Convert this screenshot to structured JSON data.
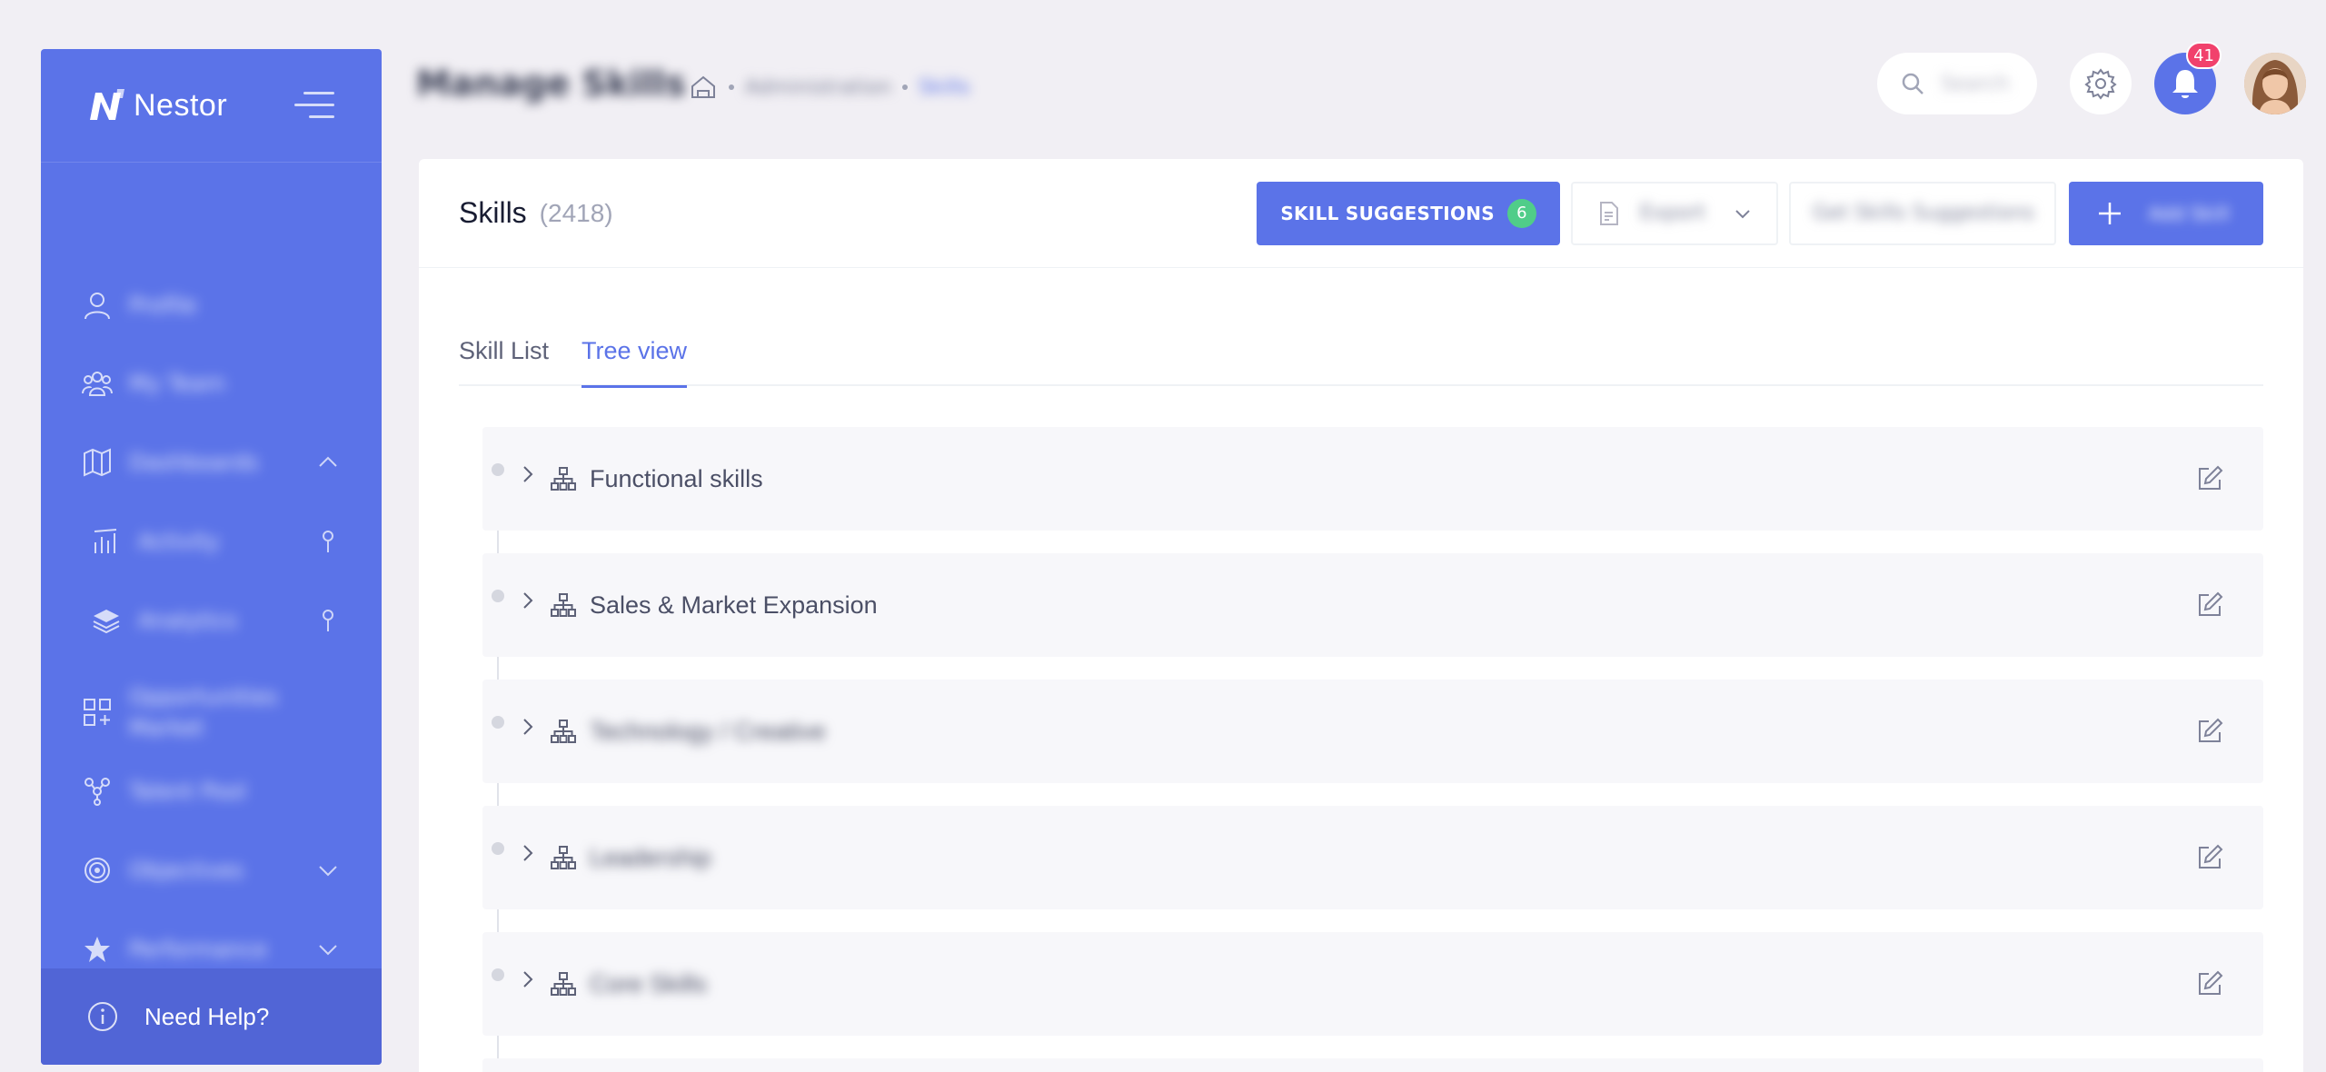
{
  "sidebar": {
    "brand": "Nestor",
    "items": [
      {
        "label": "Profile",
        "icon": "user-icon"
      },
      {
        "label": "My Team",
        "icon": "team-icon"
      },
      {
        "label": "Dashboards",
        "icon": "map-icon"
      },
      {
        "label": "Activity",
        "icon": "chart-icon"
      },
      {
        "label": "Analytics",
        "icon": "layers-icon"
      },
      {
        "label": "Opportunities Market",
        "icon": "apps-plus-icon"
      },
      {
        "label": "Talent Pool",
        "icon": "network-icon"
      },
      {
        "label": "Objectives",
        "icon": "target-icon"
      },
      {
        "label": "Performance",
        "icon": "star-icon"
      }
    ],
    "help_label": "Need Help?"
  },
  "header": {
    "title": "Manage Skills",
    "breadcrumb": [
      "Administration",
      "Skills"
    ],
    "search_placeholder": "Search",
    "notification_count": "41"
  },
  "card": {
    "title": "Skills",
    "count": "(2418)",
    "suggestions_label": "SKILL SUGGESTIONS",
    "suggestions_count": "6",
    "export_label": "Export",
    "import_label": "Get Skills Suggestions",
    "add_label": "Add Skill"
  },
  "tabs": [
    {
      "label": "Skill List",
      "active": false
    },
    {
      "label": "Tree view",
      "active": true
    }
  ],
  "tree": [
    {
      "label": "Functional skills",
      "blurred": false
    },
    {
      "label": "Sales & Market Expansion",
      "blurred": false
    },
    {
      "label": "Technology / Creative",
      "blurred": true
    },
    {
      "label": "Leadership",
      "blurred": true
    },
    {
      "label": "Core Skills",
      "blurred": true
    }
  ],
  "colors": {
    "primary": "#5b73e8",
    "success": "#50cd89",
    "danger": "#f1416c",
    "background": "#f1eff4"
  }
}
